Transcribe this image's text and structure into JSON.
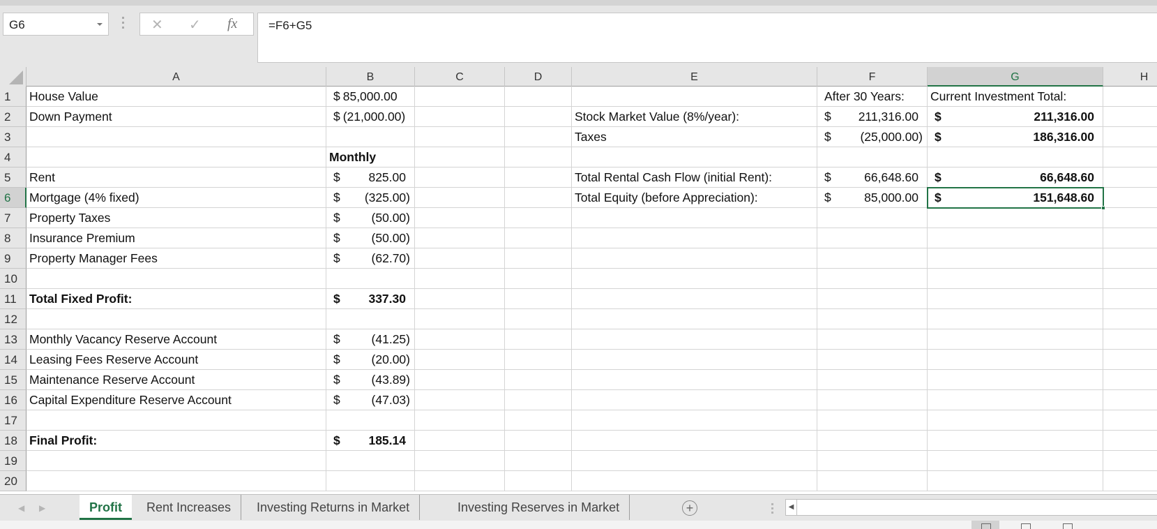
{
  "formula_bar": {
    "name_box": "G6",
    "cancel_icon": "✕",
    "enter_icon": "✓",
    "fx_label": "fx",
    "formula": "=F6+G5"
  },
  "columns": [
    "A",
    "B",
    "C",
    "D",
    "E",
    "F",
    "G",
    "H"
  ],
  "selected_column": "G",
  "selected_row": "6",
  "rows": [
    {
      "n": "1",
      "A": "House Value",
      "B": {
        "sym": "$",
        "num": "85,000.00",
        "tight": true
      },
      "E": "",
      "F": {
        "text": "After 30 Years:"
      },
      "G": {
        "text": "Current Investment Total:"
      }
    },
    {
      "n": "2",
      "A": "Down Payment",
      "B": {
        "sym": "$",
        "num": "(21,000.00)",
        "tight": true
      },
      "E": "Stock Market Value (8%/year):",
      "F": {
        "sym": "$",
        "num": "211,316.00"
      },
      "G": {
        "sym": "$",
        "num": "211,316.00"
      }
    },
    {
      "n": "3",
      "A": "",
      "E": "Taxes",
      "F": {
        "sym": "$",
        "num": "(25,000.00)"
      },
      "G": {
        "sym": "$",
        "num": "186,316.00"
      }
    },
    {
      "n": "4",
      "A": "",
      "B": {
        "text": "Monthly"
      }
    },
    {
      "n": "5",
      "A": "Rent",
      "B": {
        "sym": "$",
        "num": "825.00"
      },
      "E": "Total Rental Cash Flow (initial Rent):",
      "F": {
        "sym": "$",
        "num": "66,648.60"
      },
      "G": {
        "sym": "$",
        "num": "66,648.60"
      }
    },
    {
      "n": "6",
      "A": "Mortgage (4% fixed)",
      "B": {
        "sym": "$",
        "num": "(325.00)"
      },
      "E": "Total Equity (before Appreciation):",
      "F": {
        "sym": "$",
        "num": "85,000.00"
      },
      "G": {
        "sym": "$",
        "num": "151,648.60"
      }
    },
    {
      "n": "7",
      "A": "Property Taxes",
      "B": {
        "sym": "$",
        "num": "(50.00)"
      }
    },
    {
      "n": "8",
      "A": "Insurance Premium",
      "B": {
        "sym": "$",
        "num": "(50.00)"
      }
    },
    {
      "n": "9",
      "A": "Property Manager Fees",
      "B": {
        "sym": "$",
        "num": "(62.70)"
      }
    },
    {
      "n": "10",
      "A": ""
    },
    {
      "n": "11",
      "A": "Total Fixed Profit:",
      "B": {
        "sym": "$",
        "num": "337.30"
      }
    },
    {
      "n": "12",
      "A": ""
    },
    {
      "n": "13",
      "A": "Monthly Vacancy Reserve Account",
      "B": {
        "sym": "$",
        "num": "(41.25)"
      }
    },
    {
      "n": "14",
      "A": "Leasing Fees Reserve Account",
      "B": {
        "sym": "$",
        "num": "(20.00)"
      }
    },
    {
      "n": "15",
      "A": "Maintenance Reserve Account",
      "B": {
        "sym": "$",
        "num": "(43.89)"
      }
    },
    {
      "n": "16",
      "A": "Capital Expenditure Reserve Account",
      "B": {
        "sym": "$",
        "num": "(47.03)"
      }
    },
    {
      "n": "17",
      "A": ""
    },
    {
      "n": "18",
      "A": "Final Profit:",
      "B": {
        "sym": "$",
        "num": "185.14"
      }
    },
    {
      "n": "19",
      "A": ""
    },
    {
      "n": "20",
      "A": ""
    }
  ],
  "bold_rows": [
    "4",
    "11",
    "18"
  ],
  "bold_columns": [
    "G"
  ],
  "sheet_tabs": [
    {
      "label": "Profit",
      "active": true
    },
    {
      "label": "Rent Increases",
      "active": false
    },
    {
      "label": "Investing Returns in Market",
      "active": false
    },
    {
      "label": "Investing Reserves in Market",
      "active": false
    }
  ],
  "add_sheet_icon": "+",
  "accent_color": "#217346"
}
